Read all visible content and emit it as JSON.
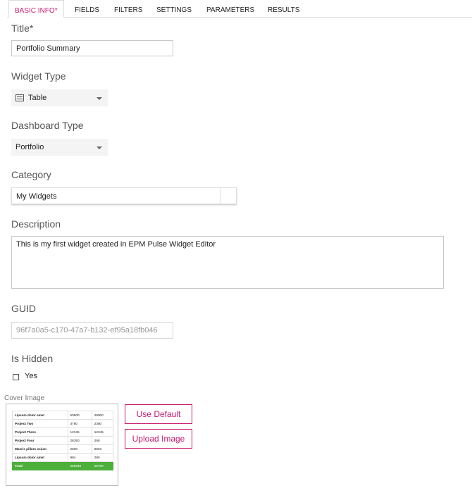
{
  "tabs": [
    {
      "label": "BASIC INFO",
      "marker": "*"
    },
    {
      "label": "FIELDS"
    },
    {
      "label": "FILTERS"
    },
    {
      "label": "SETTINGS"
    },
    {
      "label": "PARAMETERS"
    },
    {
      "label": "RESULTS"
    }
  ],
  "form": {
    "title_label": "Title*",
    "title_value": "Portfolio Summary",
    "widget_type_label": "Widget Type",
    "widget_type_value": "Table",
    "dashboard_type_label": "Dashboard Type",
    "dashboard_type_value": "Portfolio",
    "category_label": "Category",
    "category_value": "My Widgets",
    "description_label": "Description",
    "description_value": "This is my first widget created in EPM Pulse Widget Editor",
    "guid_label": "GUID",
    "guid_value": "96f7a0a5-c170-47a7-b132-ef95a18fb046",
    "is_hidden_label": "Is Hidden",
    "is_hidden_option": "Yes",
    "is_hidden_checked": false
  },
  "cover_image": {
    "label": "Cover Image",
    "rows": [
      [
        "Lipsum dolor amet",
        "60500",
        "28000"
      ],
      [
        "Project Two",
        "3780",
        "2380"
      ],
      [
        "Project Three",
        "12345",
        "12345"
      ],
      [
        "Project Four",
        "28350",
        "268"
      ],
      [
        "Maeris pillum osium",
        "2500",
        "5563"
      ],
      [
        "Lipsum dolor amet",
        "984",
        "290"
      ]
    ],
    "total": [
      "Total",
      "250840",
      "25700"
    ],
    "use_default_label": "Use Default",
    "upload_image_label": "Upload Image"
  },
  "colors": {
    "accent": "#c8196e",
    "total_row": "#4caf3a"
  }
}
